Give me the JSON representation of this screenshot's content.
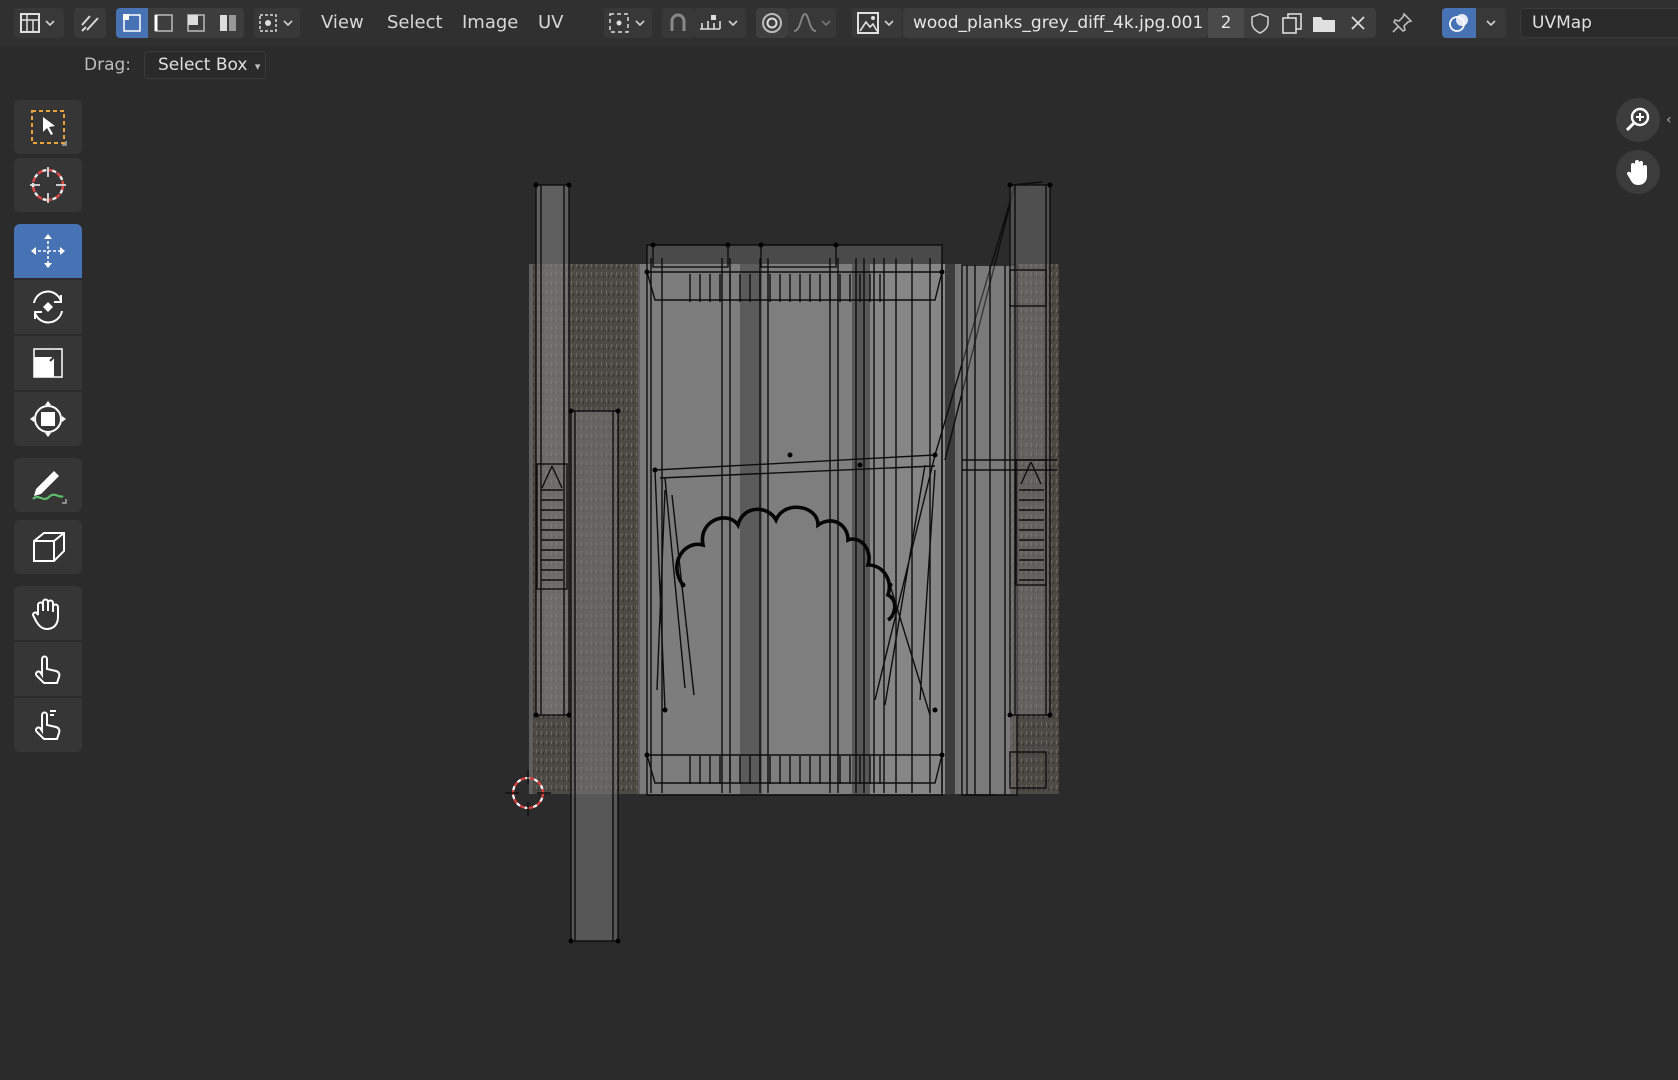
{
  "header": {
    "menus": [
      "View",
      "Select",
      "Image",
      "UV"
    ],
    "image_name": "wood_planks_grey_diff_4k.jpg.001",
    "user_count": "2",
    "uv_map": "UVMap"
  },
  "tool_settings": {
    "drag_label": "Drag:",
    "drag_value": "Select Box"
  },
  "icons": {
    "editor_type": "uv-editor-icon",
    "sync_selection": "sync-selection-icon",
    "select_modes": [
      "vertex-select-icon",
      "edge-select-icon",
      "face-select-icon",
      "island-select-icon"
    ],
    "sticky": "sticky-selection-icon",
    "pivot": "pivot-point-icon",
    "snapping": "snap-icon",
    "snap_increment": "snap-increment-icon",
    "proportional": "proportional-editing-icon",
    "falloff": "falloff-curve-icon",
    "image_browse": "image-browse-icon",
    "fake_user": "fake-user-shield-icon",
    "new_image": "new-image-icon",
    "open_image": "open-folder-icon",
    "unlink": "close-icon",
    "pin": "pin-icon",
    "overlays": "overlay-icon",
    "tools": [
      "select-box-tool-icon",
      "cursor-tool-icon",
      "move-tool-icon",
      "rotate-tool-icon",
      "scale-tool-icon",
      "transform-tool-icon",
      "annotate-tool-icon",
      "rip-region-tool-icon",
      "grab-brush-icon",
      "relax-brush-icon",
      "pinch-brush-icon"
    ],
    "nav": [
      "zoom-icon",
      "pan-hand-icon"
    ]
  },
  "colors": {
    "header_bg": "#303030",
    "viewport_bg": "#2b2b2b",
    "active_blue": "#4772b3",
    "cursor_red": "#e04040"
  }
}
